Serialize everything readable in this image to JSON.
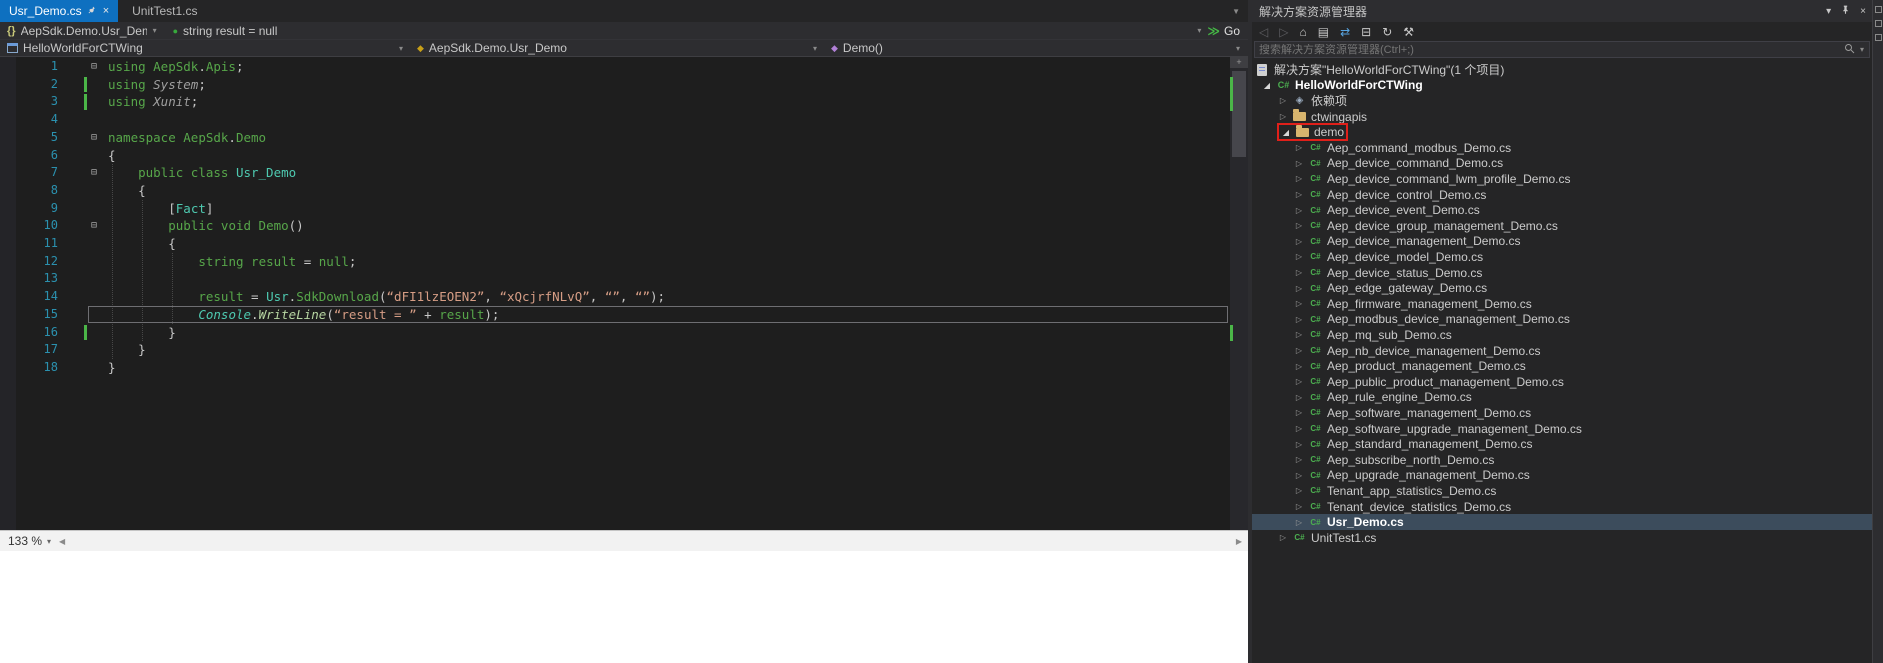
{
  "tabs": {
    "items": [
      {
        "label": "Usr_Demo.cs",
        "active": true
      },
      {
        "label": "UnitTest1.cs",
        "active": false
      }
    ]
  },
  "context_bar": {
    "scope_label": "AepSdk.Demo.Usr_Demo",
    "value_label": "string result = null",
    "go_label": "Go"
  },
  "navigation_bar": {
    "project": "HelloWorldForCTWing",
    "type": "AepSdk.Demo.Usr_Demo",
    "member": "Demo()"
  },
  "icons": {
    "chevron_down": "▾",
    "triangle_down": "▼",
    "green_dot": "●",
    "braces": "{}",
    "go_arrows": "≫",
    "diamond": "◆",
    "outline_minus": "⊟",
    "tree_collapsed": "▷",
    "tree_expanded": "◢",
    "csharp": "C#",
    "scroll_left": "◀",
    "scroll_right": "▶",
    "splitter_plus": "+",
    "close": "×"
  },
  "colors": {
    "active_tab": "#0E70C0",
    "keyword": "#57A64A",
    "type": "#4EC9B0",
    "string": "#D69D85",
    "line_number": "#2B91AF",
    "change_bar": "#4BB648",
    "annotation_red": "#E0201A",
    "selection": "#3C4C5C"
  },
  "status": {
    "zoom_label": "133 %"
  },
  "editor": {
    "lines": [
      {
        "n": 1,
        "outline": true,
        "indent": 0,
        "tokens": [
          [
            "k",
            "using "
          ],
          [
            "id",
            "AepSdk"
          ],
          [
            "p",
            "."
          ],
          [
            "id",
            "Apis"
          ],
          [
            "p",
            ";"
          ]
        ]
      },
      {
        "n": 2,
        "changed": true,
        "indent": 0,
        "tokens": [
          [
            "k",
            "using "
          ],
          [
            "ns",
            "System"
          ],
          [
            "p",
            ";"
          ]
        ]
      },
      {
        "n": 3,
        "changed": true,
        "indent": 0,
        "tokens": [
          [
            "k",
            "using "
          ],
          [
            "ns",
            "Xunit"
          ],
          [
            "p",
            ";"
          ]
        ]
      },
      {
        "n": 4,
        "indent": 0,
        "tokens": []
      },
      {
        "n": 5,
        "outline": true,
        "indent": 0,
        "tokens": [
          [
            "k",
            "namespace "
          ],
          [
            "id",
            "AepSdk"
          ],
          [
            "p",
            "."
          ],
          [
            "id",
            "Demo"
          ]
        ]
      },
      {
        "n": 6,
        "indent": 0,
        "tokens": [
          [
            "p",
            "{"
          ]
        ]
      },
      {
        "n": 7,
        "outline": true,
        "indent": 4,
        "tokens": [
          [
            "k",
            "public class "
          ],
          [
            "t",
            "Usr_Demo"
          ]
        ]
      },
      {
        "n": 8,
        "indent": 4,
        "tokens": [
          [
            "p",
            "{"
          ]
        ]
      },
      {
        "n": 9,
        "indent": 8,
        "tokens": [
          [
            "p",
            "["
          ],
          [
            "t",
            "Fact"
          ],
          [
            "p",
            "]"
          ]
        ]
      },
      {
        "n": 10,
        "outline": true,
        "indent": 8,
        "tokens": [
          [
            "k",
            "public void "
          ],
          [
            "id",
            "Demo"
          ],
          [
            "p",
            "()"
          ]
        ]
      },
      {
        "n": 11,
        "indent": 8,
        "tokens": [
          [
            "p",
            "{"
          ]
        ]
      },
      {
        "n": 12,
        "indent": 12,
        "tokens": [
          [
            "k",
            "string "
          ],
          [
            "id",
            "result"
          ],
          [
            "p",
            " = "
          ],
          [
            "k",
            "null"
          ],
          [
            "p",
            ";"
          ]
        ]
      },
      {
        "n": 13,
        "indent": 0,
        "tokens": []
      },
      {
        "n": 14,
        "indent": 12,
        "tokens": [
          [
            "id",
            "result"
          ],
          [
            "p",
            " = "
          ],
          [
            "t",
            "Usr"
          ],
          [
            "p",
            "."
          ],
          [
            "id",
            "SdkDownload"
          ],
          [
            "p",
            "("
          ],
          [
            "s",
            "“dFI1lzEOEN2”"
          ],
          [
            "p",
            ", "
          ],
          [
            "s",
            "“xQcjrfNLvQ”"
          ],
          [
            "p",
            ", "
          ],
          [
            "s",
            "“”"
          ],
          [
            "p",
            ", "
          ],
          [
            "s",
            "“”"
          ],
          [
            "p",
            ");"
          ]
        ]
      },
      {
        "n": 15,
        "current": true,
        "indent": 12,
        "tokens": [
          [
            "ti",
            "Console"
          ],
          [
            "p",
            "."
          ],
          [
            "m",
            "WriteLine"
          ],
          [
            "p",
            "("
          ],
          [
            "s",
            "“result = ”"
          ],
          [
            "p",
            " + "
          ],
          [
            "id",
            "result"
          ],
          [
            "p",
            ");"
          ]
        ]
      },
      {
        "n": 16,
        "changed": true,
        "indent": 8,
        "tokens": [
          [
            "p",
            "}"
          ]
        ]
      },
      {
        "n": 17,
        "indent": 4,
        "tokens": [
          [
            "p",
            "}"
          ]
        ]
      },
      {
        "n": 18,
        "indent": 0,
        "tokens": [
          [
            "p",
            "}"
          ]
        ]
      }
    ]
  },
  "solution_explorer": {
    "title": "解决方案资源管理器",
    "search_placeholder": "搜索解决方案资源管理器(Ctrl+;)",
    "header_icons": [
      {
        "name": "window-position-icon",
        "glyph": "▾"
      },
      {
        "name": "auto-hide-pin-icon",
        "glyph": "pin"
      },
      {
        "name": "close-icon",
        "glyph": "×"
      }
    ],
    "toolbar_icons": [
      {
        "name": "nav-back-icon",
        "glyph": "◁",
        "color": "#5E5E62"
      },
      {
        "name": "nav-forward-icon",
        "glyph": "▷",
        "color": "#5E5E62"
      },
      {
        "name": "home-icon",
        "glyph": "⌂",
        "color": "#C8C8C8"
      },
      {
        "name": "show-all-files-icon",
        "glyph": "▤",
        "color": "#C8C8C8"
      },
      {
        "name": "sync-active-document-icon",
        "glyph": "⇄",
        "color": "#57A4E0"
      },
      {
        "name": "collapse-all-icon",
        "glyph": "⊟",
        "color": "#C8C8C8"
      },
      {
        "name": "refresh-icon",
        "glyph": "↻",
        "color": "#C8C8C8"
      },
      {
        "name": "properties-icon",
        "glyph": "⚒",
        "color": "#C8C8C8"
      }
    ],
    "tree": [
      {
        "level": 0,
        "arrow": "none",
        "icon": "solution",
        "label": "解决方案\"HelloWorldForCTWing\"(1 个项目)"
      },
      {
        "level": 1,
        "arrow": "expanded",
        "icon": "project",
        "label": "HelloWorldForCTWing",
        "bold": true
      },
      {
        "level": 2,
        "arrow": "collapsed",
        "icon": "deps",
        "label": "依赖项"
      },
      {
        "level": 2,
        "arrow": "collapsed",
        "icon": "folder",
        "label": "ctwingapis"
      },
      {
        "level": 2,
        "arrow": "expanded",
        "icon": "folder",
        "label": "demo",
        "annotated": true
      },
      {
        "level": 3,
        "arrow": "collapsed",
        "icon": "cs",
        "label": "Aep_command_modbus_Demo.cs"
      },
      {
        "level": 3,
        "arrow": "collapsed",
        "icon": "cs",
        "label": "Aep_device_command_Demo.cs"
      },
      {
        "level": 3,
        "arrow": "collapsed",
        "icon": "cs",
        "label": "Aep_device_command_lwm_profile_Demo.cs"
      },
      {
        "level": 3,
        "arrow": "collapsed",
        "icon": "cs",
        "label": "Aep_device_control_Demo.cs"
      },
      {
        "level": 3,
        "arrow": "collapsed",
        "icon": "cs",
        "label": "Aep_device_event_Demo.cs"
      },
      {
        "level": 3,
        "arrow": "collapsed",
        "icon": "cs",
        "label": "Aep_device_group_management_Demo.cs"
      },
      {
        "level": 3,
        "arrow": "collapsed",
        "icon": "cs",
        "label": "Aep_device_management_Demo.cs"
      },
      {
        "level": 3,
        "arrow": "collapsed",
        "icon": "cs",
        "label": "Aep_device_model_Demo.cs"
      },
      {
        "level": 3,
        "arrow": "collapsed",
        "icon": "cs",
        "label": "Aep_device_status_Demo.cs"
      },
      {
        "level": 3,
        "arrow": "collapsed",
        "icon": "cs",
        "label": "Aep_edge_gateway_Demo.cs"
      },
      {
        "level": 3,
        "arrow": "collapsed",
        "icon": "cs",
        "label": "Aep_firmware_management_Demo.cs"
      },
      {
        "level": 3,
        "arrow": "collapsed",
        "icon": "cs",
        "label": "Aep_modbus_device_management_Demo.cs"
      },
      {
        "level": 3,
        "arrow": "collapsed",
        "icon": "cs",
        "label": "Aep_mq_sub_Demo.cs"
      },
      {
        "level": 3,
        "arrow": "collapsed",
        "icon": "cs",
        "label": "Aep_nb_device_management_Demo.cs"
      },
      {
        "level": 3,
        "arrow": "collapsed",
        "icon": "cs",
        "label": "Aep_product_management_Demo.cs"
      },
      {
        "level": 3,
        "arrow": "collapsed",
        "icon": "cs",
        "label": "Aep_public_product_management_Demo.cs"
      },
      {
        "level": 3,
        "arrow": "collapsed",
        "icon": "cs",
        "label": "Aep_rule_engine_Demo.cs"
      },
      {
        "level": 3,
        "arrow": "collapsed",
        "icon": "cs",
        "label": "Aep_software_management_Demo.cs"
      },
      {
        "level": 3,
        "arrow": "collapsed",
        "icon": "cs",
        "label": "Aep_software_upgrade_management_Demo.cs"
      },
      {
        "level": 3,
        "arrow": "collapsed",
        "icon": "cs",
        "label": "Aep_standard_management_Demo.cs"
      },
      {
        "level": 3,
        "arrow": "collapsed",
        "icon": "cs",
        "label": "Aep_subscribe_north_Demo.cs"
      },
      {
        "level": 3,
        "arrow": "collapsed",
        "icon": "cs",
        "label": "Aep_upgrade_management_Demo.cs"
      },
      {
        "level": 3,
        "arrow": "collapsed",
        "icon": "cs",
        "label": "Tenant_app_statistics_Demo.cs"
      },
      {
        "level": 3,
        "arrow": "collapsed",
        "icon": "cs",
        "label": "Tenant_device_statistics_Demo.cs"
      },
      {
        "level": 3,
        "arrow": "collapsed",
        "icon": "cs",
        "label": "Usr_Demo.cs",
        "selected": true
      },
      {
        "level": 2,
        "arrow": "collapsed",
        "icon": "cs",
        "label": "UnitTest1.cs"
      }
    ]
  }
}
